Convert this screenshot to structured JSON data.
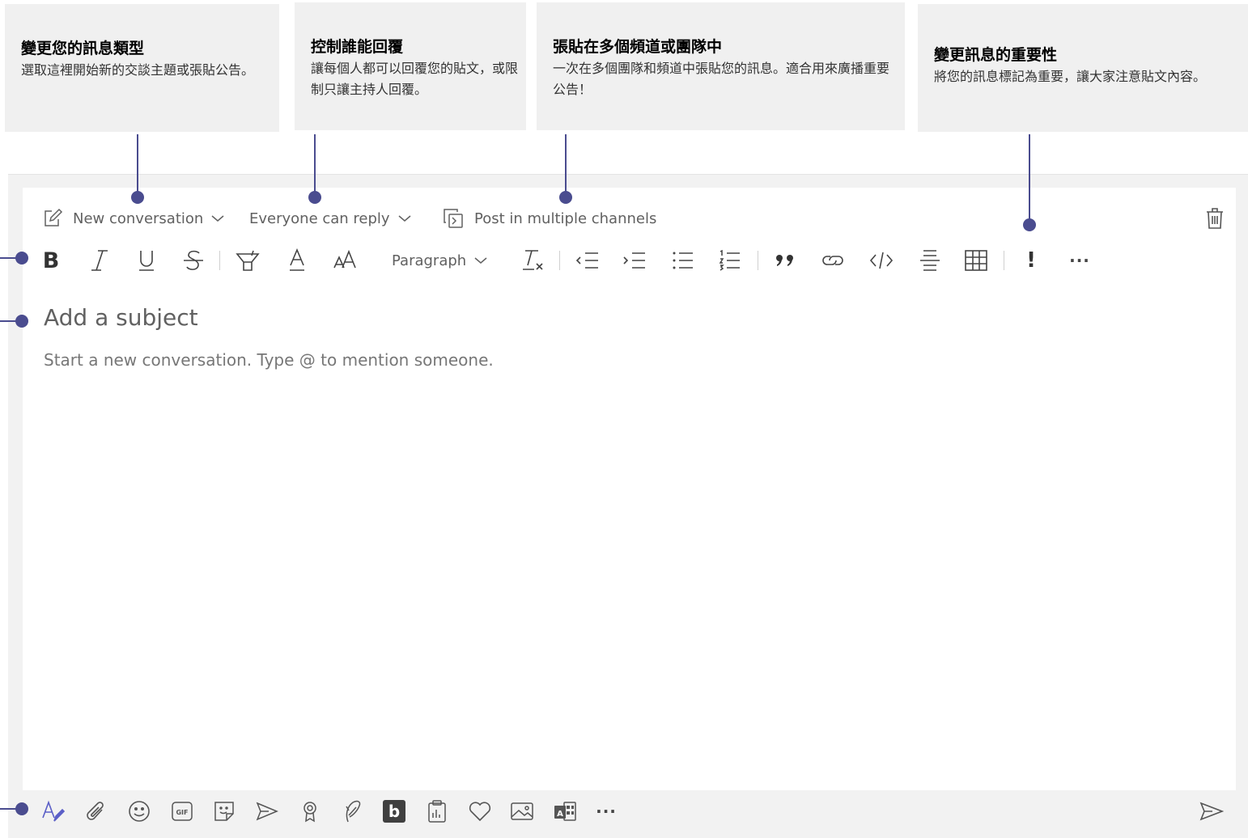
{
  "callouts": [
    {
      "title": "變更您的訊息類型",
      "desc": "選取這裡開始新的交談主題或張貼公告。"
    },
    {
      "title": "控制誰能回覆",
      "desc": "讓每個人都可以回覆您的貼文，或限制只讓主持人回覆。"
    },
    {
      "title": "張貼在多個頻道或團隊中",
      "desc": "一次在多個團隊和頻道中張貼您的訊息。適合用來廣播重要公告！"
    },
    {
      "title": "變更訊息的重要性",
      "desc": "將您的訊息標記為重要，讓大家注意貼文內容。"
    }
  ],
  "compose": {
    "new_conversation_label": "New conversation",
    "reply_label": "Everyone can reply",
    "multi_channel_label": "Post in multiple channels",
    "paragraph_label": "Paragraph",
    "subject_placeholder": "Add a subject",
    "body_placeholder": "Start a new conversation. Type @ to mention someone.",
    "bold_glyph": "B",
    "important_glyph": "!",
    "more_glyph": "···",
    "gif_label": "GIF",
    "bing_label": "b"
  },
  "colors": {
    "accent": "#4a4c8f",
    "callout_bg": "#f0f0f0",
    "frame_bg": "#f2f2f2",
    "icon": "#616161"
  }
}
